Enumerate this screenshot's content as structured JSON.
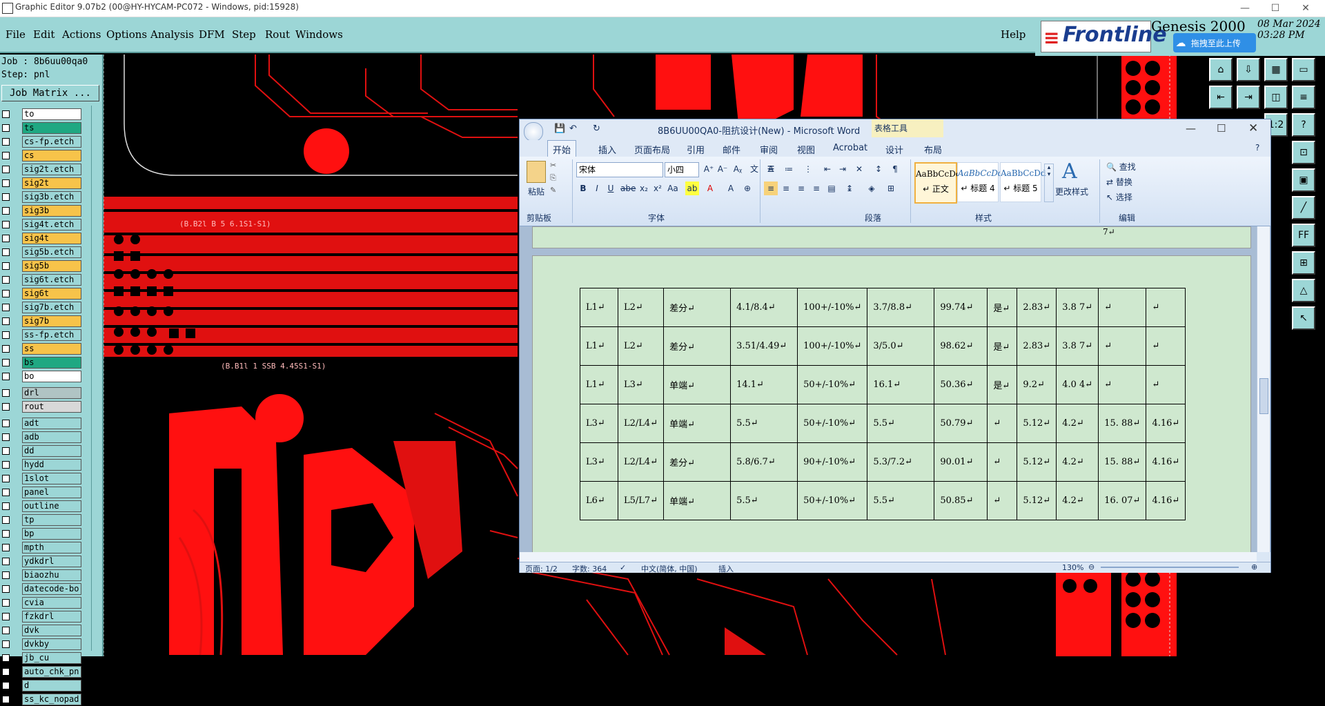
{
  "titlebar": {
    "title": "Graphic Editor 9.07b2 (00@HY-HYCAM-PC072 - Windows, pid:15928)",
    "min": "—",
    "max": "☐",
    "close": "✕"
  },
  "menubar": {
    "items": [
      "File",
      "Edit",
      "Actions",
      "Options",
      "Analysis",
      "DFM",
      "Step",
      "Rout",
      "Windows"
    ],
    "help": "Help"
  },
  "branding": {
    "logo": "Frontline",
    "product": "Genesis 2000",
    "date": "08 Mar 2024",
    "time": "03:28 PM",
    "upload": "拖拽至此上传"
  },
  "leftpanel": {
    "job": "Job : 8b6uu00qa0",
    "step": "Step: pnl",
    "job_matrix": "Job Matrix ...",
    "layers": [
      {
        "name": "to",
        "color": "#ffffff"
      },
      {
        "name": "ts",
        "color": "#1fa882"
      },
      {
        "name": "cs-fp.etch",
        "color": "#9cd6d6"
      },
      {
        "name": "cs",
        "color": "#f7c34a"
      },
      {
        "name": "sig2t.etch",
        "color": "#9cd6d6"
      },
      {
        "name": "sig2t",
        "color": "#f7c34a"
      },
      {
        "name": "sig3b.etch",
        "color": "#9cd6d6"
      },
      {
        "name": "sig3b",
        "color": "#f7c34a"
      },
      {
        "name": "sig4t.etch",
        "color": "#9cd6d6"
      },
      {
        "name": "sig4t",
        "color": "#f7c34a"
      },
      {
        "name": "sig5b.etch",
        "color": "#9cd6d6"
      },
      {
        "name": "sig5b",
        "color": "#f7c34a"
      },
      {
        "name": "sig6t.etch",
        "color": "#9cd6d6"
      },
      {
        "name": "sig6t",
        "color": "#f7c34a"
      },
      {
        "name": "sig7b.etch",
        "color": "#9cd6d6"
      },
      {
        "name": "sig7b",
        "color": "#f7c34a"
      },
      {
        "name": "ss-fp.etch",
        "color": "#9cd6d6"
      },
      {
        "name": "ss",
        "color": "#f7c34a"
      },
      {
        "name": "bs",
        "color": "#1fa882"
      },
      {
        "name": "bo",
        "color": "#ffffff"
      },
      {
        "name": "drl",
        "color": "#b0c4c4"
      },
      {
        "name": "rout",
        "color": "#d8d8d8"
      },
      {
        "name": "adt",
        "color": "#9cd6d6"
      },
      {
        "name": "adb",
        "color": "#9cd6d6"
      },
      {
        "name": "dd",
        "color": "#9cd6d6"
      },
      {
        "name": "hydd",
        "color": "#9cd6d6"
      },
      {
        "name": "1slot",
        "color": "#9cd6d6"
      },
      {
        "name": "panel",
        "color": "#9cd6d6"
      },
      {
        "name": "outline",
        "color": "#9cd6d6"
      },
      {
        "name": "tp",
        "color": "#9cd6d6"
      },
      {
        "name": "bp",
        "color": "#9cd6d6"
      },
      {
        "name": "mpth",
        "color": "#9cd6d6"
      },
      {
        "name": "ydkdrl",
        "color": "#9cd6d6"
      },
      {
        "name": "biaozhu",
        "color": "#9cd6d6"
      },
      {
        "name": "datecode-bo",
        "color": "#9cd6d6"
      },
      {
        "name": "cvia",
        "color": "#9cd6d6"
      },
      {
        "name": "fzkdrl",
        "color": "#9cd6d6"
      },
      {
        "name": "dvk",
        "color": "#9cd6d6"
      },
      {
        "name": "dvkby",
        "color": "#9cd6d6"
      },
      {
        "name": "jb_cu",
        "color": "#9cd6d6"
      },
      {
        "name": "auto_chk_pn",
        "color": "#9cd6d6"
      },
      {
        "name": "d",
        "color": "#9cd6d6"
      },
      {
        "name": "ss_kc_nopad",
        "color": "#9cd6d6"
      }
    ]
  },
  "canvas_text": {
    "label1": "(B.B2l B 5 6.1S1-S1)",
    "label2": "(B.B1l 1 SSB 4.45S1-S1)"
  },
  "word": {
    "title": "8B6UU00QA0-阻抗设计(New) - Microsoft Word",
    "contextual": "表格工具",
    "tabs": [
      "开始",
      "插入",
      "页面布局",
      "引用",
      "邮件",
      "审阅",
      "视图",
      "Acrobat",
      "设计",
      "布局"
    ],
    "ribbon": {
      "paste": "粘贴",
      "clipboard": "剪贴板",
      "font_name": "宋体",
      "font_size": "小四",
      "font_group": "字体",
      "para_group": "段落",
      "styles_group": "样式",
      "edit_group": "编辑",
      "styles": [
        {
          "preview": "AaBbCcDc",
          "name": "↵ 正文"
        },
        {
          "preview": "AaBbCcDd",
          "name": "↵ 标题 4"
        },
        {
          "preview": "AaBbCcDd",
          "name": "↵ 标题 5"
        }
      ],
      "change_styles": "更改样式",
      "find": "查找",
      "replace": "替换",
      "select": "选择"
    },
    "prev_row_last": "7↵",
    "table": [
      [
        "L1↵",
        "L2↵",
        "差分↵",
        "4.1/8.4↵",
        "100+/-10%↵",
        "3.7/8.8↵",
        "99.74↵",
        "是↵",
        "2.83↵",
        "3.8 7↵",
        "↵",
        "↵"
      ],
      [
        "L1↵",
        "L2↵",
        "差分↵",
        "3.51/4.49↵",
        "100+/-10%↵",
        "3/5.0↵",
        "98.62↵",
        "是↵",
        "2.83↵",
        "3.8 7↵",
        "↵",
        "↵"
      ],
      [
        "L1↵",
        "L3↵",
        "单端↵",
        "14.1↵",
        "50+/-10%↵",
        "16.1↵",
        "50.36↵",
        "是↵",
        "9.2↵",
        "4.0 4↵",
        "↵",
        "↵"
      ],
      [
        "L3↵",
        "L2/L4↵",
        "单端↵",
        "5.5↵",
        "50+/-10%↵",
        "5.5↵",
        "50.79↵",
        "↵",
        "5.12↵",
        "4.2↵",
        "15. 88↵",
        "4.16↵"
      ],
      [
        "L3↵",
        "L2/L4↵",
        "差分↵",
        "5.8/6.7↵",
        "90+/-10%↵",
        "5.3/7.2↵",
        "90.01↵",
        "↵",
        "5.12↵",
        "4.2↵",
        "15. 88↵",
        "4.16↵"
      ],
      [
        "L6↵",
        "L5/L7↵",
        "单端↵",
        "5.5↵",
        "50+/-10%↵",
        "5.5↵",
        "50.85↵",
        "↵",
        "5.12↵",
        "4.2↵",
        "16. 07↵",
        "4.16↵"
      ]
    ],
    "status": {
      "page": "页面: 1/2",
      "words": "字数: 364",
      "lang": "中文(简体, 中国)",
      "mode": "插入",
      "zoom": "130%"
    }
  }
}
